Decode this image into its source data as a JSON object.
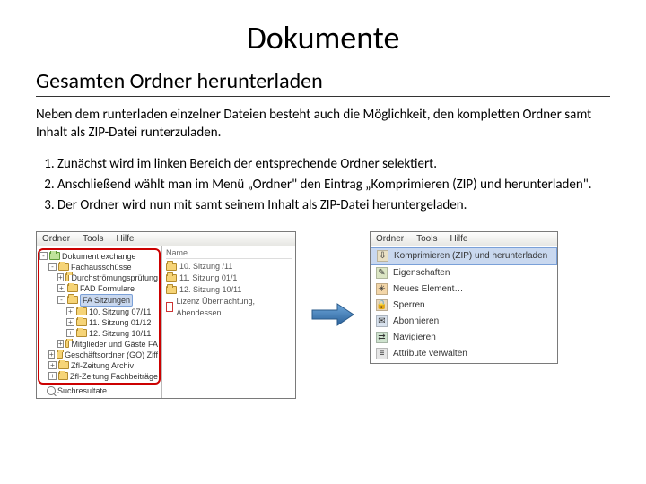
{
  "title": "Dokumente",
  "subtitle": "Gesamten Ordner herunterladen",
  "intro": "Neben dem runterladen einzelner Dateien besteht auch die Möglichkeit, den kompletten Ordner samt Inhalt als ZIP-Datei runterzuladen.",
  "steps": [
    "Zunächst wird im linken Bereich der entsprechende Ordner selektiert.",
    "Anschließend wählt man im Menü „Ordner\" den Eintrag „Komprimieren (ZIP) und herunterladen\".",
    "Der Ordner wird nun mit samt seinem Inhalt als ZIP-Datei heruntergeladen."
  ],
  "left_menubar": [
    "Ordner",
    "Tools",
    "Hilfe"
  ],
  "tree": [
    {
      "indent": 0,
      "toggle": "-",
      "color": "green",
      "label": "Dokument exchange"
    },
    {
      "indent": 1,
      "toggle": "-",
      "color": "yellow",
      "label": "Fachausschüsse"
    },
    {
      "indent": 2,
      "toggle": "+",
      "color": "yellow",
      "label": "Durchströmungsprüfung"
    },
    {
      "indent": 2,
      "toggle": "+",
      "color": "yellow",
      "label": "FAD Formulare"
    },
    {
      "indent": 2,
      "toggle": "-",
      "color": "yellow",
      "label": "FA Sitzungen",
      "selected": true
    },
    {
      "indent": 3,
      "toggle": "+",
      "color": "yellow",
      "label": "10. Sitzung 07/11"
    },
    {
      "indent": 3,
      "toggle": "+",
      "color": "yellow",
      "label": "11. Sitzung 01/12"
    },
    {
      "indent": 3,
      "toggle": "+",
      "color": "yellow",
      "label": "12. Sitzung 10/11"
    },
    {
      "indent": 2,
      "toggle": "+",
      "color": "yellow",
      "label": "Mitglieder und Gäste FA"
    },
    {
      "indent": 1,
      "toggle": "+",
      "color": "yellow",
      "label": "Geschäftsordner (GO) Ziff"
    },
    {
      "indent": 1,
      "toggle": "+",
      "color": "yellow",
      "label": "Zfl-Zeitung Archiv"
    },
    {
      "indent": 1,
      "toggle": "+",
      "color": "yellow",
      "label": "Zfl-Zeitung Fachbeiträge"
    }
  ],
  "search_label": "Suchresultate",
  "file_header": "Name",
  "files": [
    {
      "icon": "folder",
      "label": "10. Sitzung /11"
    },
    {
      "icon": "folder",
      "label": "11. Sitzung 01/1"
    },
    {
      "icon": "folder",
      "label": "12. Sitzung 10/11"
    },
    {
      "icon": "pdf",
      "label": "Lizenz Übernachtung, Abendessen"
    }
  ],
  "right_menubar": [
    "Ordner",
    "Tools",
    "Hilfe"
  ],
  "dropdown": [
    {
      "label": "Komprimieren (ZIP) und herunterladen",
      "selected": true,
      "icon_bg": "#e9e0c4",
      "icon": "⇩"
    },
    {
      "label": "Eigenschaften",
      "icon_bg": "#dce6c4",
      "icon": "✎"
    },
    {
      "label": "Neues Element…",
      "icon_bg": "#f3d6a8",
      "icon": "✳"
    },
    {
      "label": "Sperren",
      "icon_bg": "#ead7b8",
      "icon": "🔒"
    },
    {
      "label": "Abonnieren",
      "icon_bg": "#d8e2ee",
      "icon": "✉"
    },
    {
      "label": "Navigieren",
      "icon_bg": "#cfe3cf",
      "icon": "⇄"
    },
    {
      "label": "Attribute verwalten",
      "icon_bg": "#e6e6e6",
      "icon": "≡"
    }
  ]
}
